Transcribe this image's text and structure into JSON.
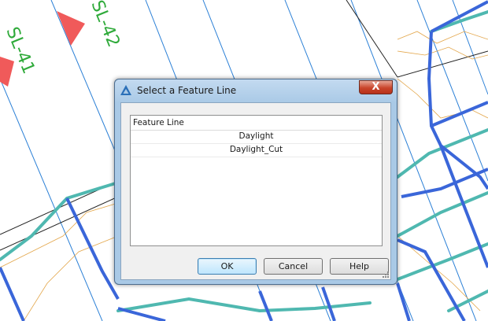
{
  "drawing": {
    "labels": [
      "SL-41",
      "SL-42"
    ]
  },
  "dialog": {
    "title": "Select a Feature Line",
    "close_label": "X",
    "list": {
      "column_header": "Feature Line",
      "rows": [
        "Daylight",
        "Daylight_Cut"
      ]
    },
    "buttons": {
      "ok": "OK",
      "cancel": "Cancel",
      "help": "Help"
    }
  },
  "colors": {
    "background": "#ffffff",
    "alignment_line": "#2a7fd6",
    "corridor_line": "#3a66d9",
    "teal_line": "#4fb8b0",
    "label_green": "#2faa3a",
    "marker_red": "#f05a5a",
    "dialog_frame": "#a9c9e6",
    "close_button": "#c9452b"
  }
}
